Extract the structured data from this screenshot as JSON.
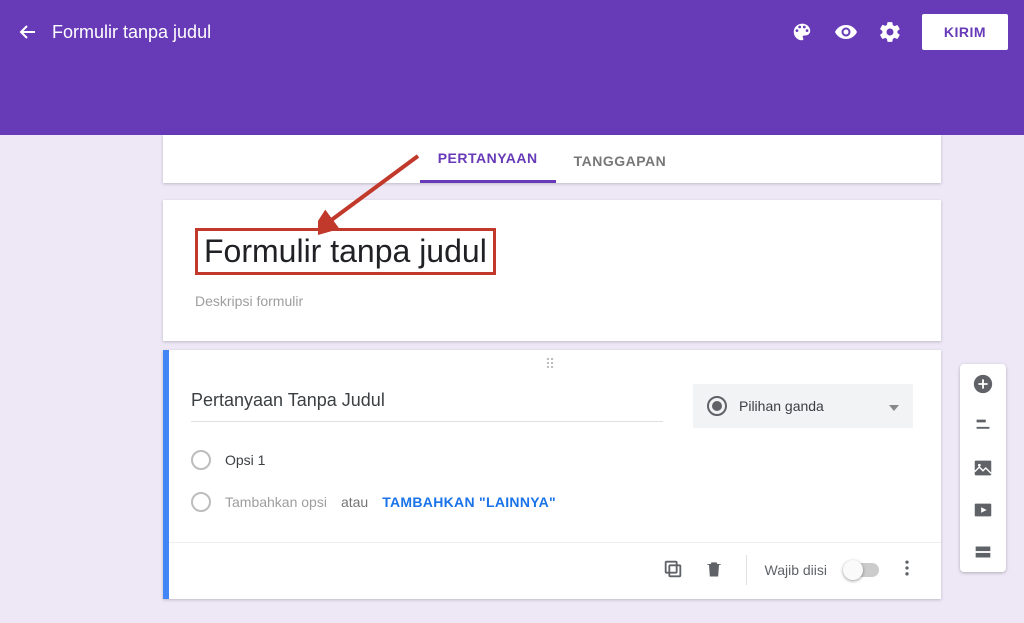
{
  "header": {
    "doc_title": "Formulir tanpa judul",
    "send_label": "KIRIM"
  },
  "tabs": {
    "questions": "PERTANYAAN",
    "responses": "TANGGAPAN"
  },
  "form": {
    "title": "Formulir tanpa judul",
    "description_placeholder": "Deskripsi formulir"
  },
  "question": {
    "title": "Pertanyaan Tanpa Judul",
    "type_label": "Pilihan ganda",
    "option1": "Opsi 1",
    "add_option": "Tambahkan opsi",
    "or": "atau",
    "add_other": "TAMBAHKAN \"LAINNYA\"",
    "required_label": "Wajib diisi"
  }
}
